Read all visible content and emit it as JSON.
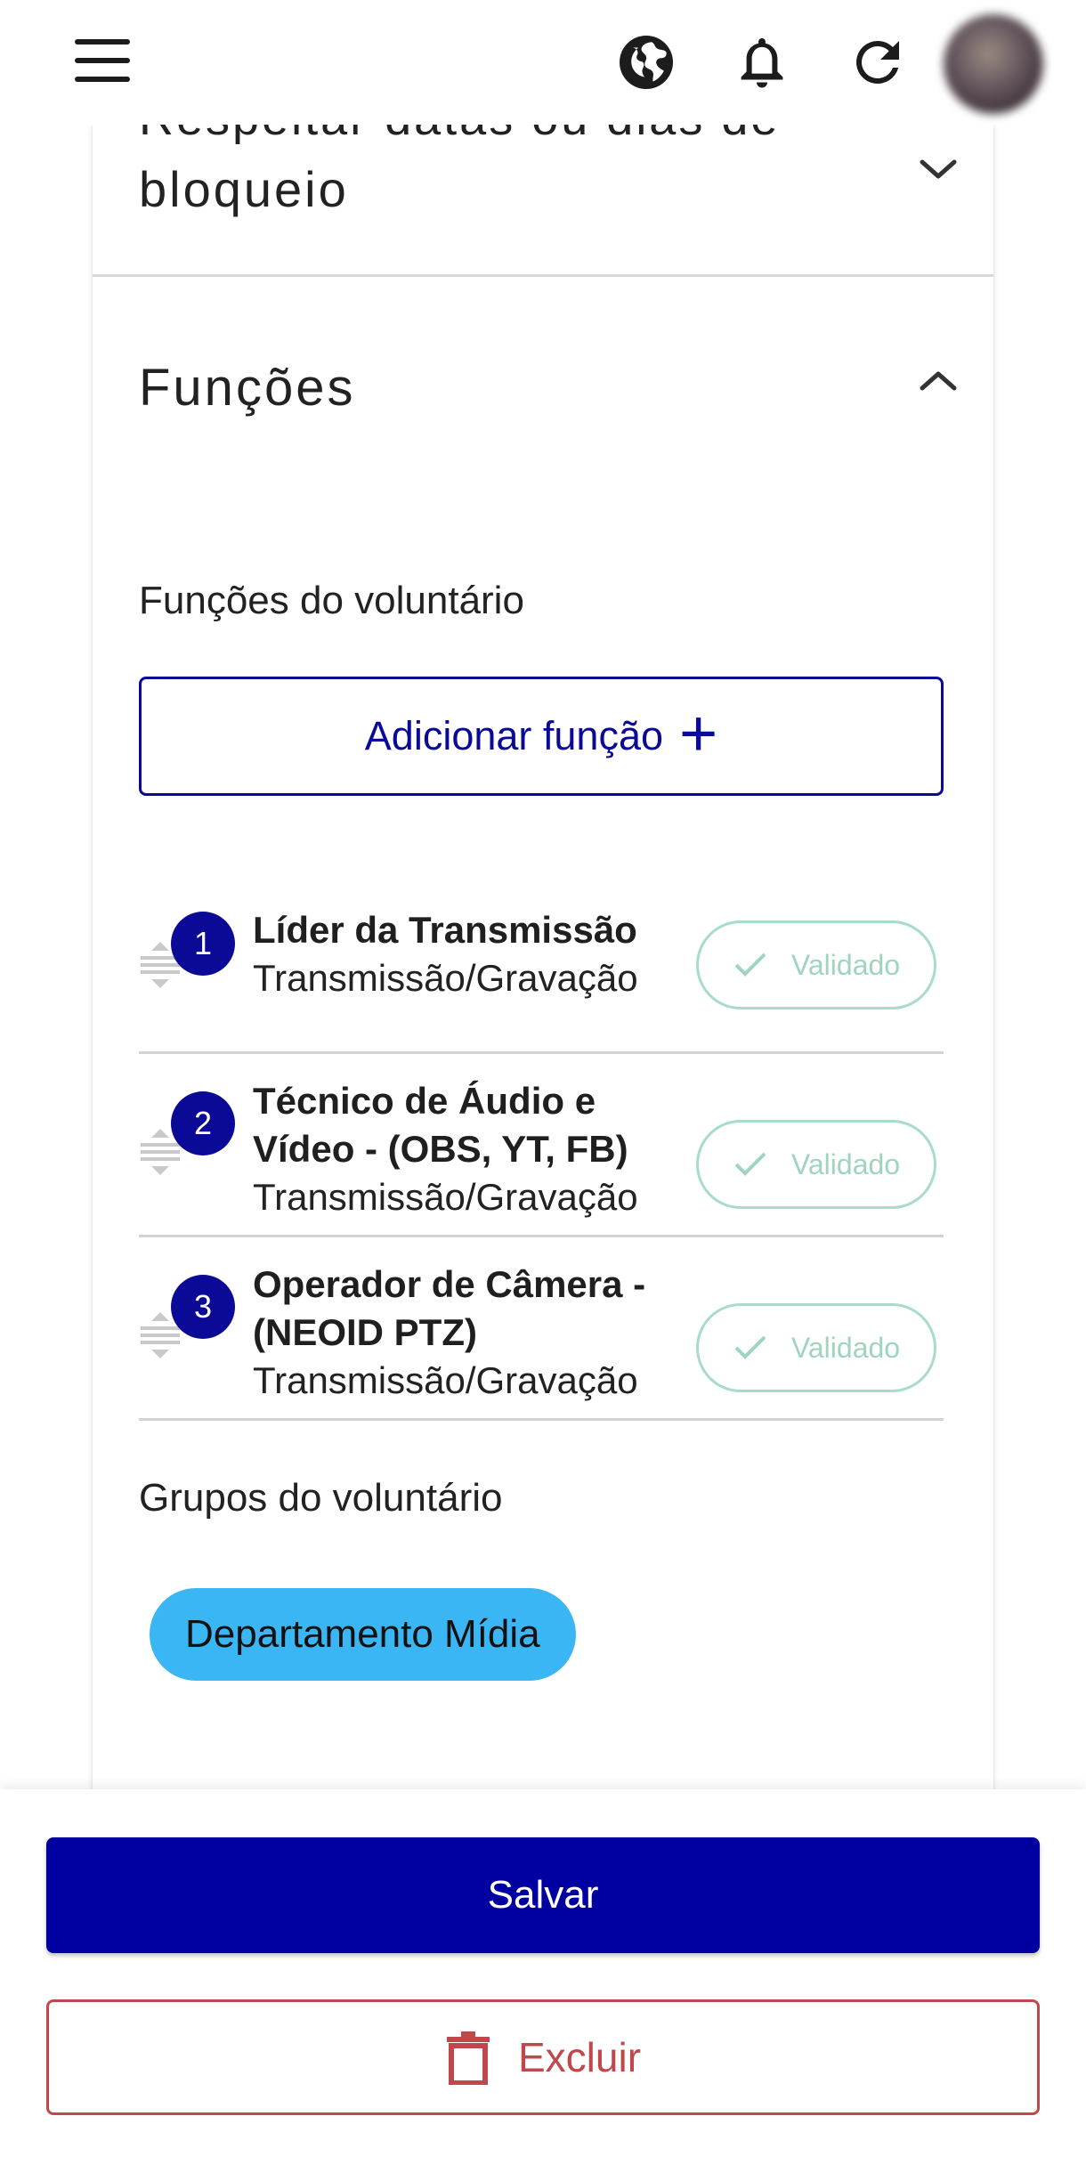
{
  "header": {
    "menu_icon": "menu-icon",
    "language_icon": "globe-icon",
    "notifications_icon": "bell-icon",
    "refresh_icon": "refresh-icon"
  },
  "collapsed_section": {
    "partial_text": "Respeitar datas ou dias de",
    "title": "bloqueio",
    "state": "collapsed"
  },
  "functions_section": {
    "title": "Funções",
    "state": "expanded",
    "volunteer_functions_label": "Funções do voluntário",
    "add_function_label": "Adicionar função",
    "functions": [
      {
        "order": "1",
        "title_lines": [
          "Líder da Transmissão"
        ],
        "area": "Transmissão/Gravação",
        "status": "Validado"
      },
      {
        "order": "2",
        "title_lines": [
          "Técnico de Áudio e",
          "Vídeo - (OBS, YT, FB)"
        ],
        "area": "Transmissão/Gravação",
        "status": "Validado"
      },
      {
        "order": "3",
        "title_lines": [
          "Operador de Câmera -",
          "(NEOID PTZ)"
        ],
        "area": "Transmissão/Gravação",
        "status": "Validado"
      }
    ],
    "volunteer_groups_label": "Grupos do voluntário",
    "groups": [
      "Departamento Mídia"
    ]
  },
  "footer": {
    "save_label": "Salvar",
    "delete_label": "Excluir"
  },
  "colors": {
    "primary": "#0a0a96",
    "validated_green": "#9fd4be",
    "group_chip": "#3bb6f5",
    "danger": "#c0484d"
  }
}
